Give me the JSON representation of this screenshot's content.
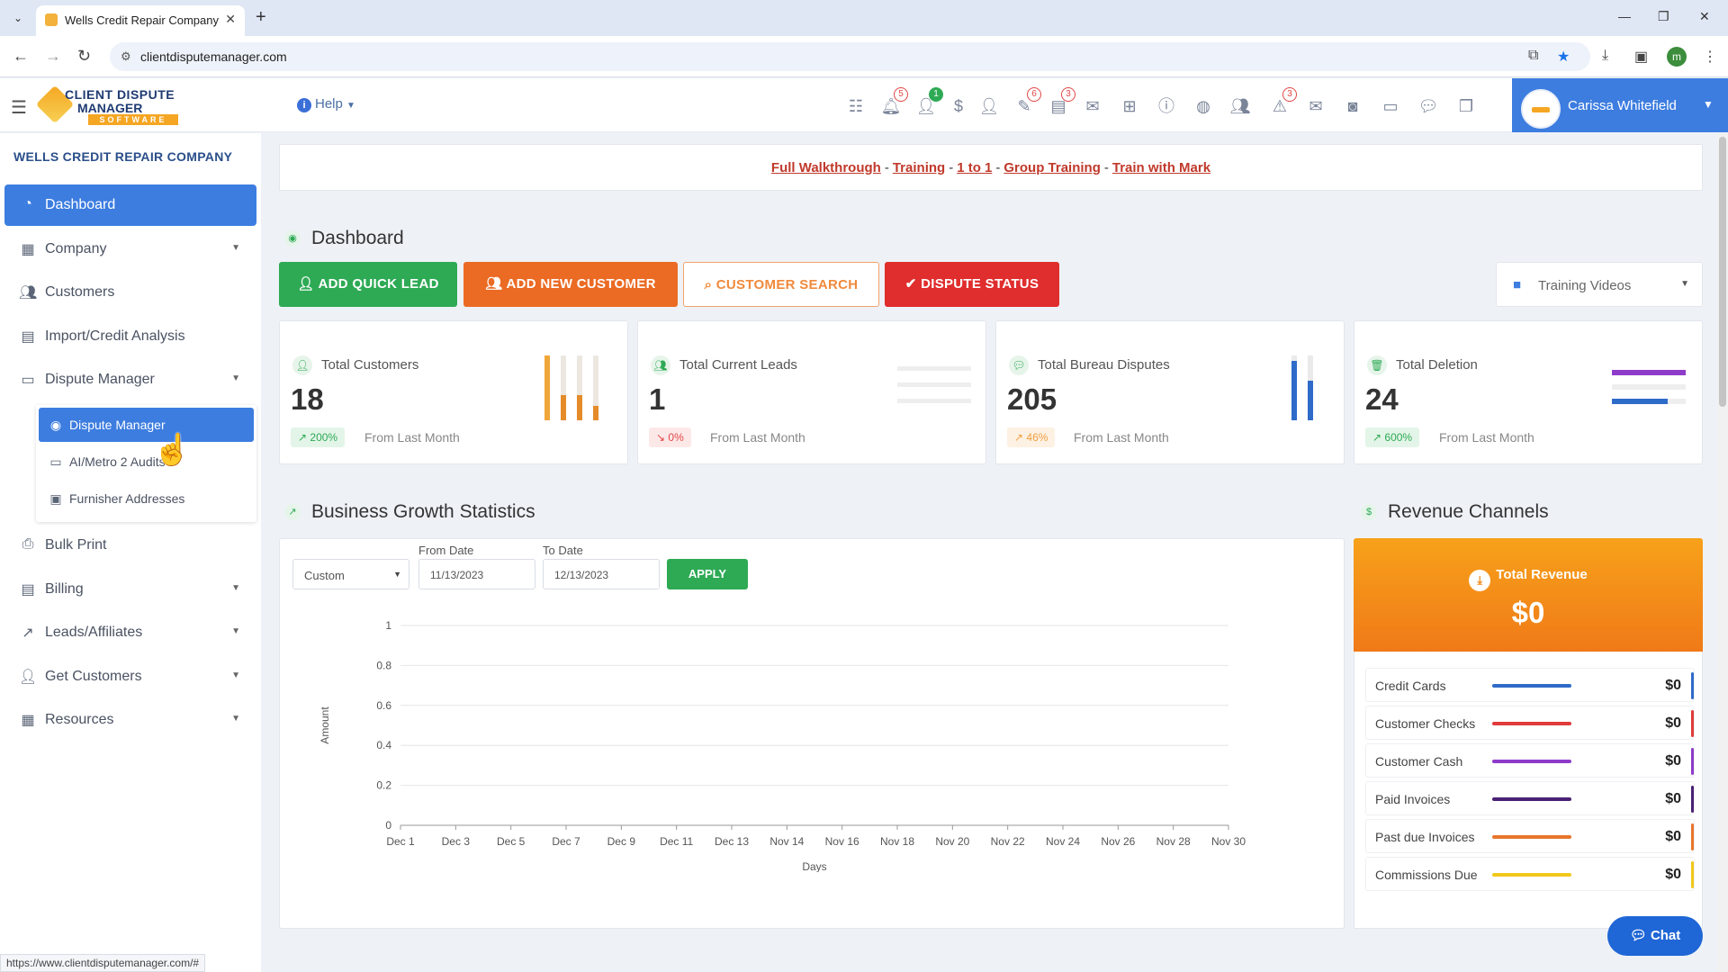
{
  "browser": {
    "tab_title": "Wells Credit Repair Company",
    "url": "clientdisputemanager.com",
    "status_url": "https://www.clientdisputemanager.com/#",
    "profile_letter": "m"
  },
  "header": {
    "logo_line1": "CLIENT DISPUTE",
    "logo_line2": "MANAGER",
    "logo_line3": "SOFTWARE",
    "help_label": "Help",
    "badges": {
      "notifications": "5",
      "users_online": "1",
      "tools": "6",
      "docs": "3",
      "alerts": "3"
    },
    "user_name": "Carissa Whitefield"
  },
  "sidebar": {
    "company_name": "WELLS CREDIT REPAIR COMPANY",
    "items": [
      {
        "label": "Dashboard"
      },
      {
        "label": "Company"
      },
      {
        "label": "Customers"
      },
      {
        "label": "Import/Credit Analysis"
      },
      {
        "label": "Dispute Manager"
      },
      {
        "label": "Bulk Print"
      },
      {
        "label": "Billing"
      },
      {
        "label": "Leads/Affiliates"
      },
      {
        "label": "Get Customers"
      },
      {
        "label": "Resources"
      }
    ],
    "submenu": [
      {
        "label": "Dispute Manager"
      },
      {
        "label": "AI/Metro 2 Audits"
      },
      {
        "label": "Furnisher Addresses"
      }
    ]
  },
  "banner": {
    "links": [
      "Full Walkthrough",
      "Training",
      "1 to 1",
      "Group Training",
      "Train with Mark"
    ],
    "separator": "-"
  },
  "dashboard": {
    "title": "Dashboard",
    "buttons": {
      "add_quick_lead": "ADD QUICK LEAD",
      "add_new_customer": "ADD NEW CUSTOMER",
      "customer_search": "CUSTOMER SEARCH",
      "dispute_status": "DISPUTE STATUS"
    },
    "training_videos": "Training Videos",
    "stats": [
      {
        "label": "Total Customers",
        "value": "18",
        "pct": "200%",
        "from": "From Last Month"
      },
      {
        "label": "Total Current Leads",
        "value": "1",
        "pct": "0%",
        "from": "From Last Month"
      },
      {
        "label": "Total Bureau Disputes",
        "value": "205",
        "pct": "46%",
        "from": "From Last Month"
      },
      {
        "label": "Total Deletion",
        "value": "24",
        "pct": "600%",
        "from": "From Last Month"
      }
    ]
  },
  "growth": {
    "title": "Business Growth Statistics",
    "range": "Custom",
    "from_label": "From Date",
    "from_value": "11/13/2023",
    "to_label": "To Date",
    "to_value": "12/13/2023",
    "apply_label": "APPLY"
  },
  "chart_data": {
    "type": "line",
    "title": "",
    "xlabel": "Days",
    "ylabel": "Amount",
    "categories": [
      "Dec 1",
      "Dec 3",
      "Dec 5",
      "Dec 7",
      "Dec 9",
      "Dec 11",
      "Dec 13",
      "Nov 14",
      "Nov 16",
      "Nov 18",
      "Nov 20",
      "Nov 22",
      "Nov 24",
      "Nov 26",
      "Nov 28",
      "Nov 30"
    ],
    "yticks": [
      0,
      0.2,
      0.4,
      0.6,
      0.8,
      1
    ],
    "ylim": [
      0,
      1
    ],
    "series": [],
    "grid": true
  },
  "revenue": {
    "title": "Revenue Channels",
    "total_label": "Total Revenue",
    "total_value": "$0",
    "rows": [
      {
        "label": "Credit Cards",
        "value": "$0",
        "color": "#2f6bc9"
      },
      {
        "label": "Customer Checks",
        "value": "$0",
        "color": "#e03b3b"
      },
      {
        "label": "Customer Cash",
        "value": "$0",
        "color": "#8e3bc9"
      },
      {
        "label": "Paid Invoices",
        "value": "$0",
        "color": "#4a2173"
      },
      {
        "label": "Past due Invoices",
        "value": "$0",
        "color": "#e8752a"
      },
      {
        "label": "Commissions Due",
        "value": "$0",
        "color": "#f2c81a"
      }
    ]
  },
  "chat": {
    "label": "Chat"
  }
}
